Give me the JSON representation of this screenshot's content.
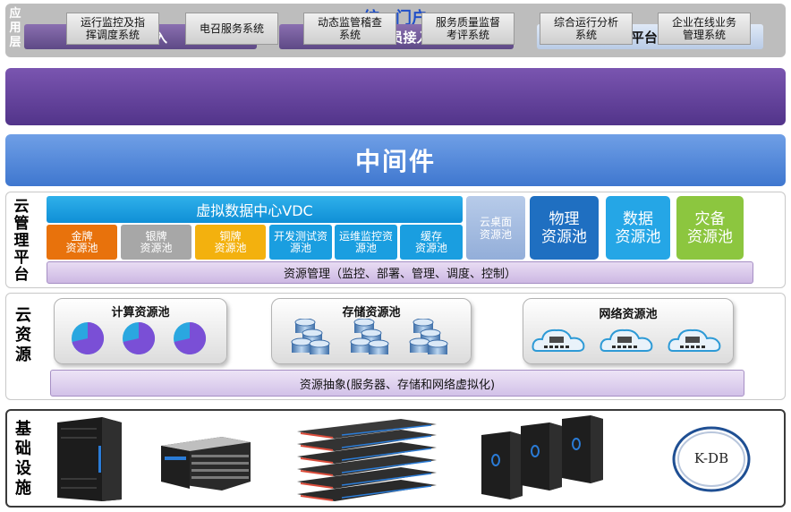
{
  "portal": {
    "title": "统一门户",
    "buttons": [
      "用户接入",
      "管理员接入",
      "第三方平台API接口"
    ]
  },
  "app_layer": {
    "label": [
      "应",
      "用",
      "层"
    ],
    "items": [
      [
        "运行监控及指",
        "挥调度系统"
      ],
      [
        "电召服务系统"
      ],
      [
        "动态监管稽查",
        "系统"
      ],
      [
        "服务质量监督",
        "考评系统"
      ],
      [
        "综合运行分析",
        "系统"
      ],
      [
        "企业在线业务",
        "管理系统"
      ]
    ]
  },
  "middleware": {
    "title": "中间件"
  },
  "cloud_mgmt": {
    "label": [
      "云",
      "管",
      "理",
      "平",
      "台"
    ],
    "vdc": "虚拟数据中心VDC",
    "pools": [
      {
        "lines": [
          "金牌",
          "资源池"
        ],
        "color": "#e8720c"
      },
      {
        "lines": [
          "银牌",
          "资源池"
        ],
        "color": "#a7a7a7"
      },
      {
        "lines": [
          "铜牌",
          "资源池"
        ],
        "color": "#f3b10e"
      },
      {
        "lines": [
          "开发测试资",
          "源池"
        ],
        "color": "#1a9ee0"
      },
      {
        "lines": [
          "运维监控资",
          "源池"
        ],
        "color": "#1a9ee0"
      },
      {
        "lines": [
          "缓存",
          "资源池"
        ],
        "color": "#1a9ee0"
      }
    ],
    "desktop_pool": [
      "云桌面",
      "资源池"
    ],
    "big_pools": [
      {
        "lines": [
          "物理",
          "资源池"
        ],
        "color": "#1f6fc1"
      },
      {
        "lines": [
          "数据",
          "资源池"
        ],
        "color": "#25a6e6"
      },
      {
        "lines": [
          "灾备",
          "资源池"
        ],
        "color": "#8cc63f"
      }
    ],
    "resource_mgmt": "资源管理（监控、部署、管理、调度、控制）"
  },
  "cloud_resource": {
    "label": [
      "云",
      "资",
      "源"
    ],
    "compute": "计算资源池",
    "storage": "存储资源池",
    "network": "网络资源池",
    "abstraction": "资源抽象(服务器、存储和网络虚拟化)"
  },
  "infrastructure": {
    "label": [
      "基",
      "础",
      "设",
      "施"
    ],
    "kdb": "K-DB"
  },
  "colors": {
    "accent_purple": "#5e4a86",
    "middleware_blue": "#3f77cf",
    "title_blue": "#1f4fc9"
  }
}
